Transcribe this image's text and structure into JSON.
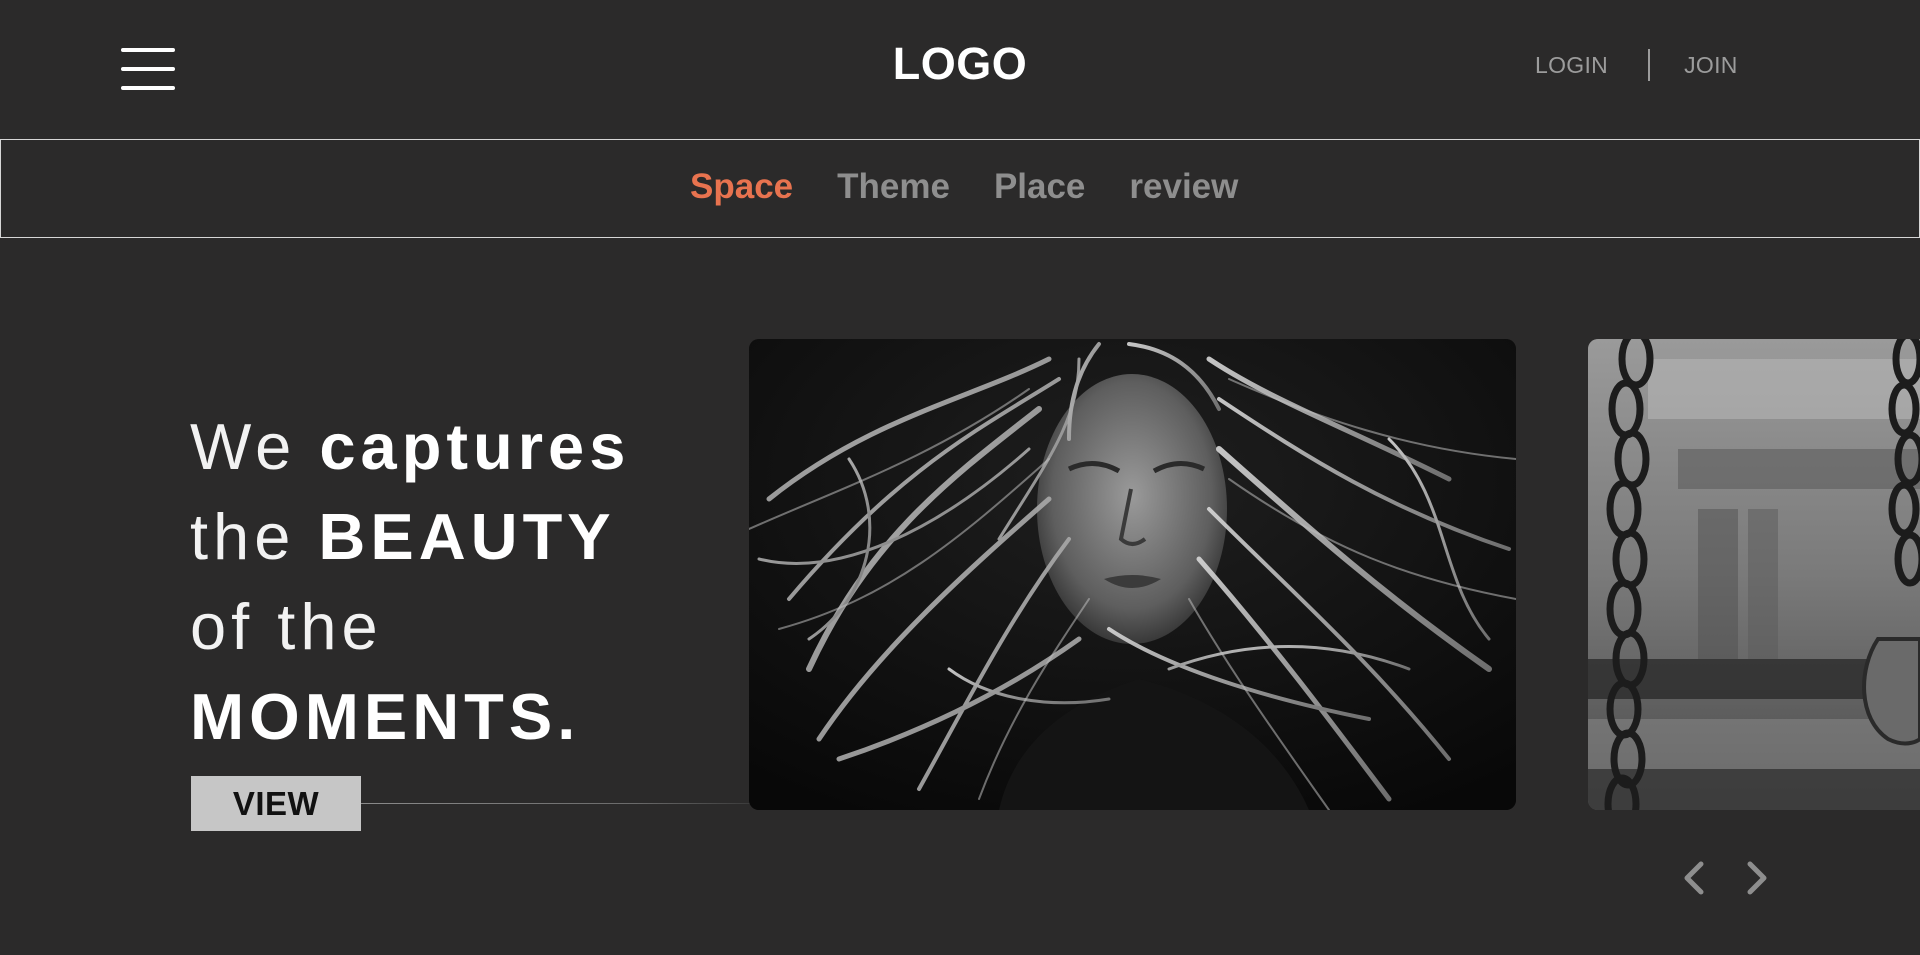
{
  "header": {
    "menu_icon": "hamburger-menu-icon",
    "logo": "LOGO",
    "login": "LOGIN",
    "join": "JOIN"
  },
  "nav": {
    "items": [
      {
        "label": "Space",
        "active": true
      },
      {
        "label": "Theme",
        "active": false
      },
      {
        "label": "Place",
        "active": false
      },
      {
        "label": "review",
        "active": false
      }
    ]
  },
  "hero": {
    "line1_light": "We ",
    "line1_bold": "captures",
    "line2_light": "the ",
    "line2_bold": "BEAUTY",
    "line3_light": "of the",
    "line4_bold": "MOMENTS."
  },
  "view_button": "VIEW",
  "carousel": {
    "prev_icon": "chevron-left-icon",
    "next_icon": "chevron-right-icon"
  },
  "colors": {
    "background": "#2b2a2a",
    "accent": "#e8734f",
    "nav_inactive": "#8e8e8e",
    "button_bg": "#c6c6c6"
  }
}
